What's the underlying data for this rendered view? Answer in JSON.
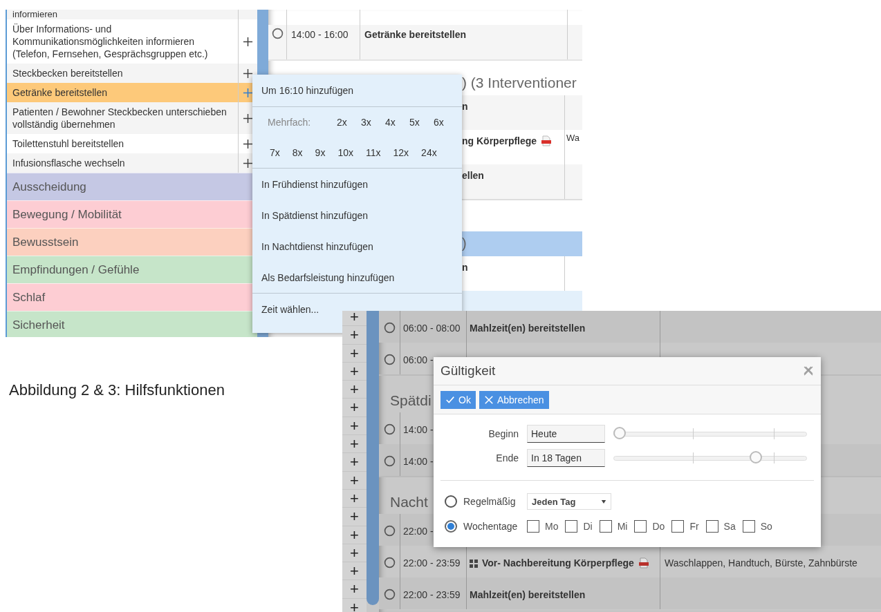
{
  "list": {
    "items": [
      {
        "label": "informieren",
        "selected": false,
        "add": false
      },
      {
        "label": "Über Informations- und Kommunikationsmöglichkeiten informieren (Telefon, Fernsehen, Gesprächsgruppen etc.)",
        "selected": false,
        "add": true
      },
      {
        "label": "Steckbecken bereitstellen",
        "selected": false,
        "add": true
      },
      {
        "label": "Getränke bereitstellen",
        "selected": true,
        "add": true
      },
      {
        "label": "Patienten / Bewohner Steckbecken unterschieben vollständig übernehmen",
        "selected": false,
        "add": true
      },
      {
        "label": "Toilettenstuhl bereitstellen",
        "selected": false,
        "add": true
      },
      {
        "label": "Infusionsflasche wechseln",
        "selected": false,
        "add": true
      }
    ],
    "categories": [
      {
        "label": "Ausscheidung",
        "color": "#c5c8e4"
      },
      {
        "label": "Bewegung / Mobilität",
        "color": "#fdcdd3"
      },
      {
        "label": "Bewusstsein",
        "color": "#fcd0bf"
      },
      {
        "label": "Empfindungen / Gefühle",
        "color": "#c6e5c9"
      },
      {
        "label": "Schlaf",
        "color": "#fdcdd3"
      },
      {
        "label": "Sicherheit",
        "color": "#c6e5c9"
      }
    ]
  },
  "schedule": {
    "top_row": {
      "time": "14:00 - 16:00",
      "title": "Getränke bereitstellen"
    },
    "heading": ") (3 Interventioner",
    "header_fragment": "n",
    "rows": [
      {
        "title": "ng Körperpflege",
        "pdf": true,
        "note": "Wa"
      },
      {
        "title": "ellen",
        "pdf": false,
        "note": ""
      }
    ],
    "bar_fragment": ")",
    "bar_row_fragment": "n"
  },
  "context_menu": {
    "first": "Um 16:10 hinzufügen",
    "multiples_label": "Mehrfach:",
    "multiples": [
      "2x",
      "3x",
      "4x",
      "5x",
      "6x",
      "7x",
      "8x",
      "9x",
      "10x",
      "11x",
      "12x",
      "24x"
    ],
    "shift_items": [
      "In Frühdienst hinzufügen",
      "In Spätdienst hinzufügen",
      "In Nachtdienst hinzufügen",
      "Als Bedarfsleistung hinzufügen"
    ],
    "last": "Zeit wählen..."
  },
  "caption": "Abbildung 2 & 3: Hilfsfunktionen",
  "plan": {
    "add_buttons": [
      "+",
      "+",
      "+",
      "+",
      "+",
      "+",
      "+",
      "+",
      "+",
      "+",
      "+",
      "+",
      "+",
      "+",
      "+",
      "+",
      "+"
    ],
    "rows": [
      {
        "kind": "row",
        "time": "06:00 - 08:00",
        "title": "Mahlzeit(en) bereitstellen",
        "grid": false,
        "pdf": false,
        "note": ""
      },
      {
        "kind": "row",
        "time": "06:00 -"
      },
      {
        "kind": "heading",
        "title": "Spätdi"
      },
      {
        "kind": "row",
        "time": "14:00 -"
      },
      {
        "kind": "row",
        "time": "14:00 -"
      },
      {
        "kind": "heading",
        "title": "Nacht"
      },
      {
        "kind": "row",
        "time": "22:00 -"
      },
      {
        "kind": "row",
        "time": "22:00 - 23:59",
        "title": "Vor- Nachbereitung Körperpflege",
        "grid": true,
        "pdf": true,
        "note": "Waschlappen, Handtuch, Bürste, Zahnbürste"
      },
      {
        "kind": "row",
        "time": "22:00 - 23:59",
        "title": "Mahlzeit(en) bereitstellen",
        "grid": false,
        "pdf": false,
        "note": ""
      }
    ]
  },
  "dialog": {
    "title": "Gültigkeit",
    "ok": "Ok",
    "cancel": "Abbrechen",
    "ranges": [
      {
        "label": "Beginn",
        "value": "Heute",
        "level": 0
      },
      {
        "label": "Ende",
        "value": "In 18 Tagen",
        "level": 0.75
      }
    ],
    "modes": [
      {
        "label": "Regelmäßig",
        "selected": false,
        "kind": "select",
        "value": "Jeden Tag"
      },
      {
        "label": "Wochentage",
        "selected": true,
        "kind": "days"
      }
    ],
    "days": [
      {
        "label": "Mo",
        "checked": false
      },
      {
        "label": "Di",
        "checked": false
      },
      {
        "label": "Mi",
        "checked": false
      },
      {
        "label": "Do",
        "checked": false
      },
      {
        "label": "Fr",
        "checked": false
      },
      {
        "label": "Sa",
        "checked": false
      },
      {
        "label": "So",
        "checked": false
      }
    ]
  }
}
